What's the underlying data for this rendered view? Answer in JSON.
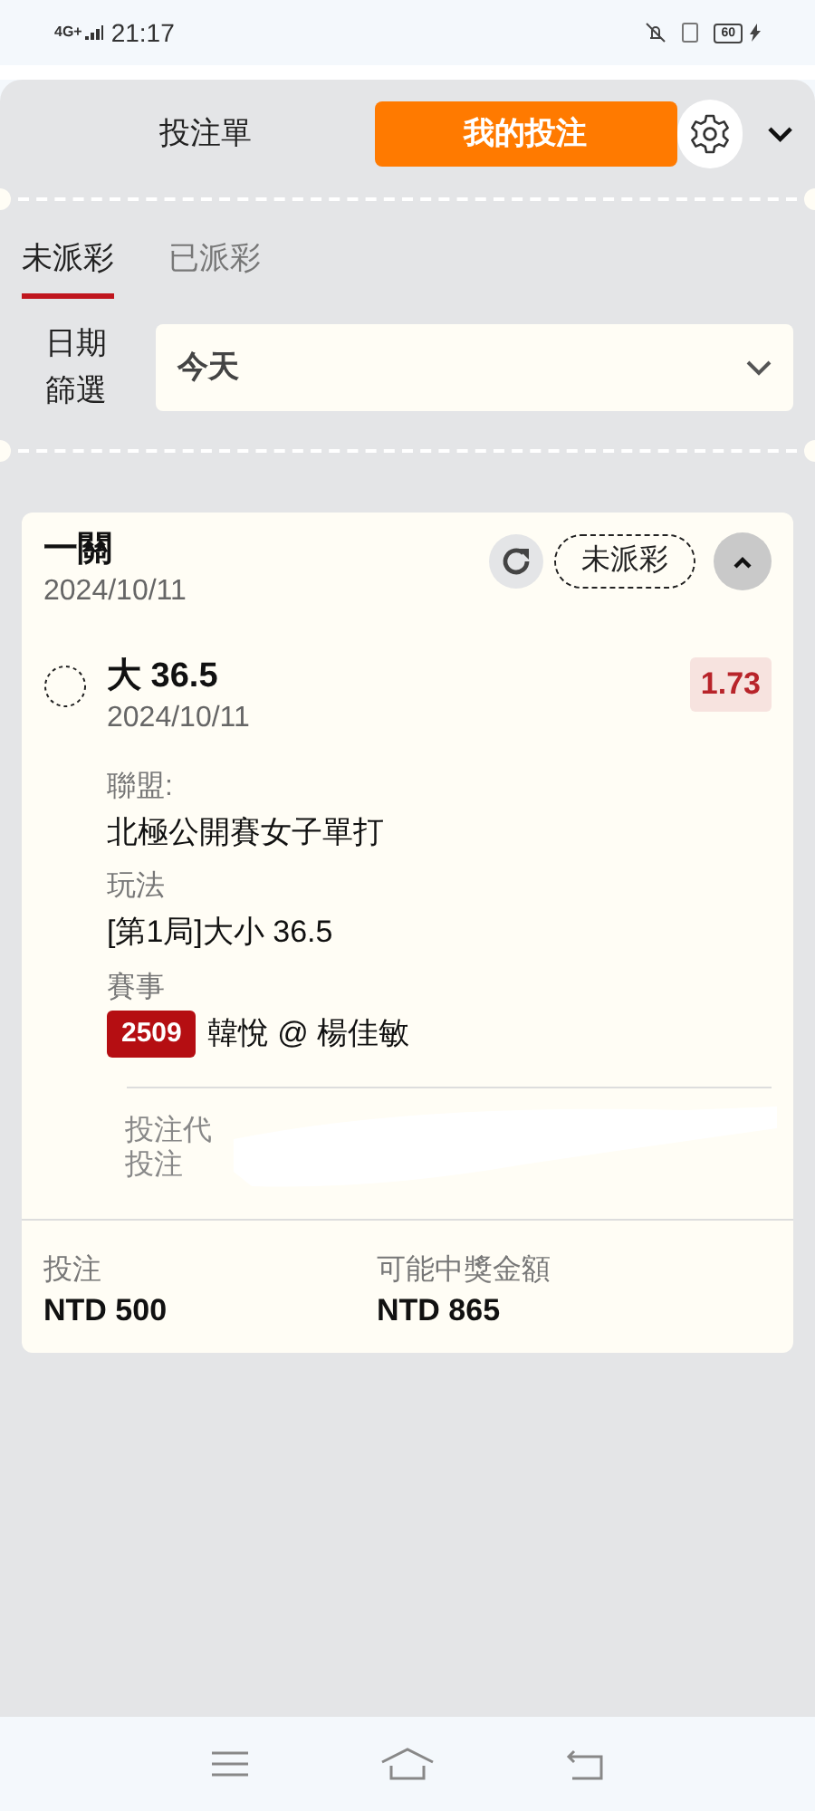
{
  "status_bar": {
    "network": "4G+",
    "time": "21:17",
    "battery": "60"
  },
  "header": {
    "tabs": [
      {
        "label": "投注單",
        "selected": false
      },
      {
        "label": "我的投注",
        "selected": true
      }
    ]
  },
  "filter_tabs": [
    {
      "label": "未派彩",
      "selected": true
    },
    {
      "label": "已派彩",
      "selected": false
    }
  ],
  "date_filter": {
    "label": "日期篩選",
    "value": "今天"
  },
  "bet_card": {
    "title": "一關",
    "date": "2024/10/11",
    "status": "未派彩",
    "expanded": true,
    "selection": {
      "pick": "大 36.5",
      "date": "2024/10/11",
      "odds": "1.73",
      "details": [
        {
          "label": "聯盟:",
          "value": "北極公開賽女子單打"
        },
        {
          "label": "玩法",
          "value": "[第1局]大小 36.5"
        },
        {
          "label": "賽事",
          "badge": "2509",
          "value": "韓悅 @ 楊佳敏"
        }
      ]
    },
    "redacted_lines": [
      "投注代",
      "投注"
    ],
    "stake": {
      "label": "投注",
      "value": "NTD 500"
    },
    "payout": {
      "label": "可能中獎金額",
      "value": "NTD 865"
    }
  }
}
